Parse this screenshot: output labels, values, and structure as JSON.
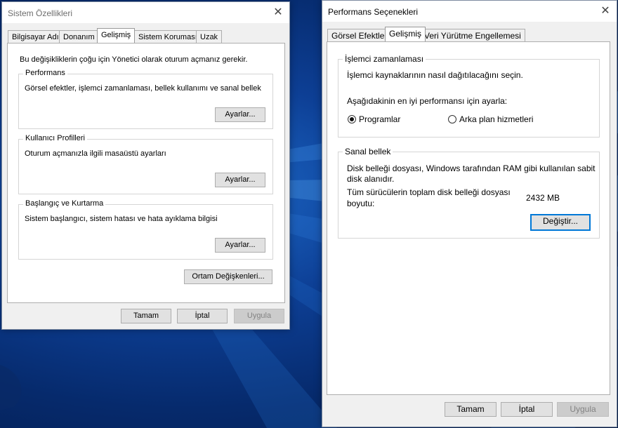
{
  "sysprops": {
    "title": "Sistem Özellikleri",
    "tabs": [
      "Bilgisayar Adı",
      "Donanım",
      "Gelişmiş",
      "Sistem Koruması",
      "Uzak"
    ],
    "admin_note": "Bu değişikliklerin çoğu için Yönetici olarak oturum açmanız gerekir.",
    "performance": {
      "legend": "Performans",
      "desc": "Görsel efektler, işlemci zamanlaması, bellek kullanımı ve sanal bellek",
      "button": "Ayarlar..."
    },
    "profiles": {
      "legend": "Kullanıcı Profilleri",
      "desc": "Oturum açmanızla ilgili masaüstü ayarları",
      "button": "Ayarlar..."
    },
    "startup": {
      "legend": "Başlangıç ve Kurtarma",
      "desc": "Sistem başlangıcı, sistem hatası ve hata ayıklama bilgisi",
      "button": "Ayarlar..."
    },
    "env_button": "Ortam Değişkenleri...",
    "ok": "Tamam",
    "cancel": "İptal",
    "apply": "Uygula"
  },
  "perfopts": {
    "title": "Performans Seçenekleri",
    "tabs": [
      "Görsel Efektler",
      "Gelişmiş",
      "Veri Yürütme Engellemesi"
    ],
    "cpu": {
      "legend": "İşlemci zamanlaması",
      "desc": "İşlemci kaynaklarının nasıl dağıtılacağını seçin.",
      "adjust": "Aşağıdakinin en iyi performansı için ayarla:",
      "opt_programs": "Programlar",
      "opt_background": "Arka plan hizmetleri",
      "selected": "Programlar"
    },
    "vm": {
      "legend": "Sanal bellek",
      "desc_line1": "Disk belleği dosyası, Windows tarafından RAM gibi kullanılan sabit",
      "desc_line2": "disk alanıdır.",
      "total_line1": "Tüm sürücülerin toplam disk belleği dosyası",
      "total_line2": "boyutu:",
      "total_value": "2432 MB",
      "change_button": "Değiştir..."
    },
    "ok": "Tamam",
    "cancel": "İptal",
    "apply": "Uygula"
  }
}
